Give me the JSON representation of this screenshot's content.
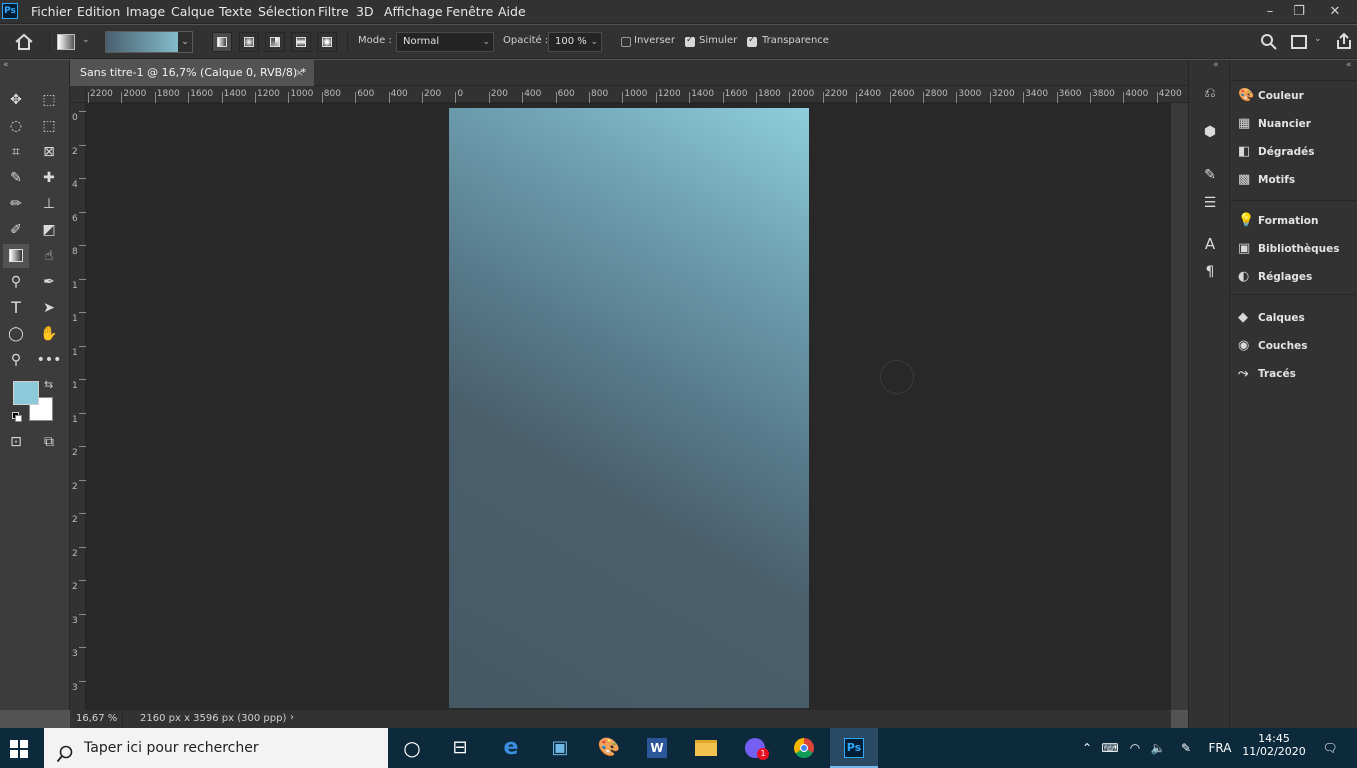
{
  "menubar": {
    "logo": "Ps",
    "items": [
      "Fichier",
      "Edition",
      "Image",
      "Calque",
      "Texte",
      "Sélection",
      "Filtre",
      "3D",
      "Affichage",
      "Fenêtre",
      "Aide"
    ],
    "window_controls": {
      "minimize": "–",
      "restore": "❐",
      "close": "✕"
    }
  },
  "options": {
    "mode_label": "Mode :",
    "mode_value": "Normal",
    "opacity_label": "Opacité :",
    "opacity_value": "100 %",
    "inverser": "Inverser",
    "simuler": "Simuler",
    "transparence": "Transparence",
    "inverser_checked": false,
    "simuler_checked": true,
    "transparence_checked": true
  },
  "document": {
    "tab_title": "Sans titre-1 @ 16,7% (Calque 0, RVB/8) *",
    "tab_close": "×",
    "gradient_colors": [
      "#8fcedc",
      "#455965"
    ]
  },
  "ruler": {
    "h_ticks": [
      "2200",
      "2000",
      "1800",
      "1600",
      "1400",
      "1200",
      "1000",
      "800",
      "600",
      "400",
      "200",
      "0",
      "200",
      "400",
      "600",
      "800",
      "1000",
      "1200",
      "1400",
      "1600",
      "1800",
      "2000",
      "2200",
      "2400",
      "2600",
      "2800",
      "3000",
      "3200",
      "3400",
      "3600",
      "3800",
      "4000",
      "4200"
    ],
    "v_ticks": [
      "0",
      "2",
      "4",
      "6",
      "8",
      "1",
      "1",
      "1",
      "1",
      "1",
      "2",
      "2",
      "2",
      "2",
      "2",
      "3",
      "3",
      "3"
    ]
  },
  "status": {
    "zoom": "16,67 %",
    "info": "2160 px x 3596 px (300 ppp)",
    "arrow": "›"
  },
  "toolbox": {
    "foreground_color": "#8cc9d9",
    "background_color": "#ffffff"
  },
  "panels": {
    "group1": [
      {
        "label": "Couleur",
        "icon": "palette-icon"
      },
      {
        "label": "Nuancier",
        "icon": "grid-icon"
      },
      {
        "label": "Dégradés",
        "icon": "gradient-icon"
      },
      {
        "label": "Motifs",
        "icon": "pattern-icon"
      }
    ],
    "group2": [
      {
        "label": "Formation",
        "icon": "lightbulb-icon"
      },
      {
        "label": "Bibliothèques",
        "icon": "library-icon"
      },
      {
        "label": "Réglages",
        "icon": "adjustments-icon"
      }
    ],
    "group3": [
      {
        "label": "Calques",
        "icon": "layers-icon"
      },
      {
        "label": "Couches",
        "icon": "channels-icon"
      },
      {
        "label": "Tracés",
        "icon": "paths-icon"
      }
    ]
  },
  "taskbar": {
    "search_placeholder": "Taper ici pour rechercher",
    "language": "FRA",
    "time": "14:45",
    "date": "11/02/2020",
    "viber_badge": "1",
    "ps_label": "Ps"
  }
}
